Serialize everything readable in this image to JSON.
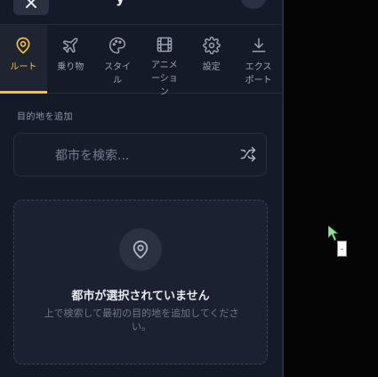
{
  "header": {
    "title_fragment": "y"
  },
  "tabs": [
    {
      "label": "ルート",
      "icon": "map-pin-icon",
      "active": true
    },
    {
      "label": "乗り物",
      "icon": "airplane-icon",
      "active": false
    },
    {
      "label": "スタイル",
      "icon": "palette-icon",
      "active": false
    },
    {
      "label": "アニメーション",
      "icon": "film-icon",
      "active": false
    },
    {
      "label": "設定",
      "icon": "gear-icon",
      "active": false
    },
    {
      "label": "エクスポート",
      "icon": "download-icon",
      "active": false
    }
  ],
  "route": {
    "section_label": "目的地を追加",
    "search_placeholder": "都市を検索...",
    "shuffle_icon": "shuffle-icon"
  },
  "empty_state": {
    "icon": "map-pin-icon",
    "title": "都市が選択されていません",
    "description": "上で検索して最初の目的地を追加してください。"
  },
  "overlay": {
    "tiny_box_text": "-"
  },
  "colors": {
    "accent": "#f2c14b",
    "panel_bg": "#141a28",
    "page_bg": "#050505"
  }
}
